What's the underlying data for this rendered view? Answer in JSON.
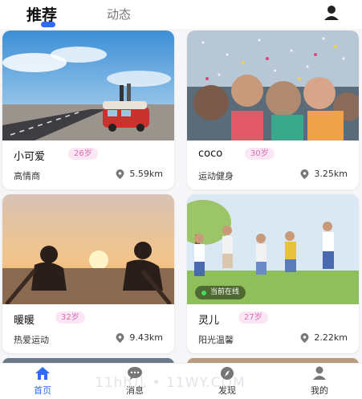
{
  "header": {
    "tabs": [
      {
        "label": "推荐",
        "active": true
      },
      {
        "label": "动态",
        "active": false
      }
    ],
    "accent": "#2e6cf6",
    "right_icon": "user-icon"
  },
  "cards": [
    {
      "name": "小可爱",
      "age": "26岁",
      "tag": "高情商",
      "distance": "5.59km",
      "online": ""
    },
    {
      "name": "coco",
      "age": "30岁",
      "tag": "运动健身",
      "distance": "3.25km",
      "online": ""
    },
    {
      "name": "暖暖",
      "age": "32岁",
      "tag": "热爱运动",
      "distance": "9.43km",
      "online": ""
    },
    {
      "name": "灵儿",
      "age": "27岁",
      "tag": "阳光温馨",
      "distance": "2.22km",
      "online": "当前在线"
    }
  ],
  "nav": {
    "items": [
      {
        "label": "首页",
        "icon": "home-icon",
        "active": true
      },
      {
        "label": "消息",
        "icon": "message-icon",
        "active": false
      },
      {
        "label": "发现",
        "icon": "compass-icon",
        "active": false
      },
      {
        "label": "我的",
        "icon": "profile-icon",
        "active": false
      }
    ]
  },
  "watermark": "11hh儿 • 11WY.COM"
}
